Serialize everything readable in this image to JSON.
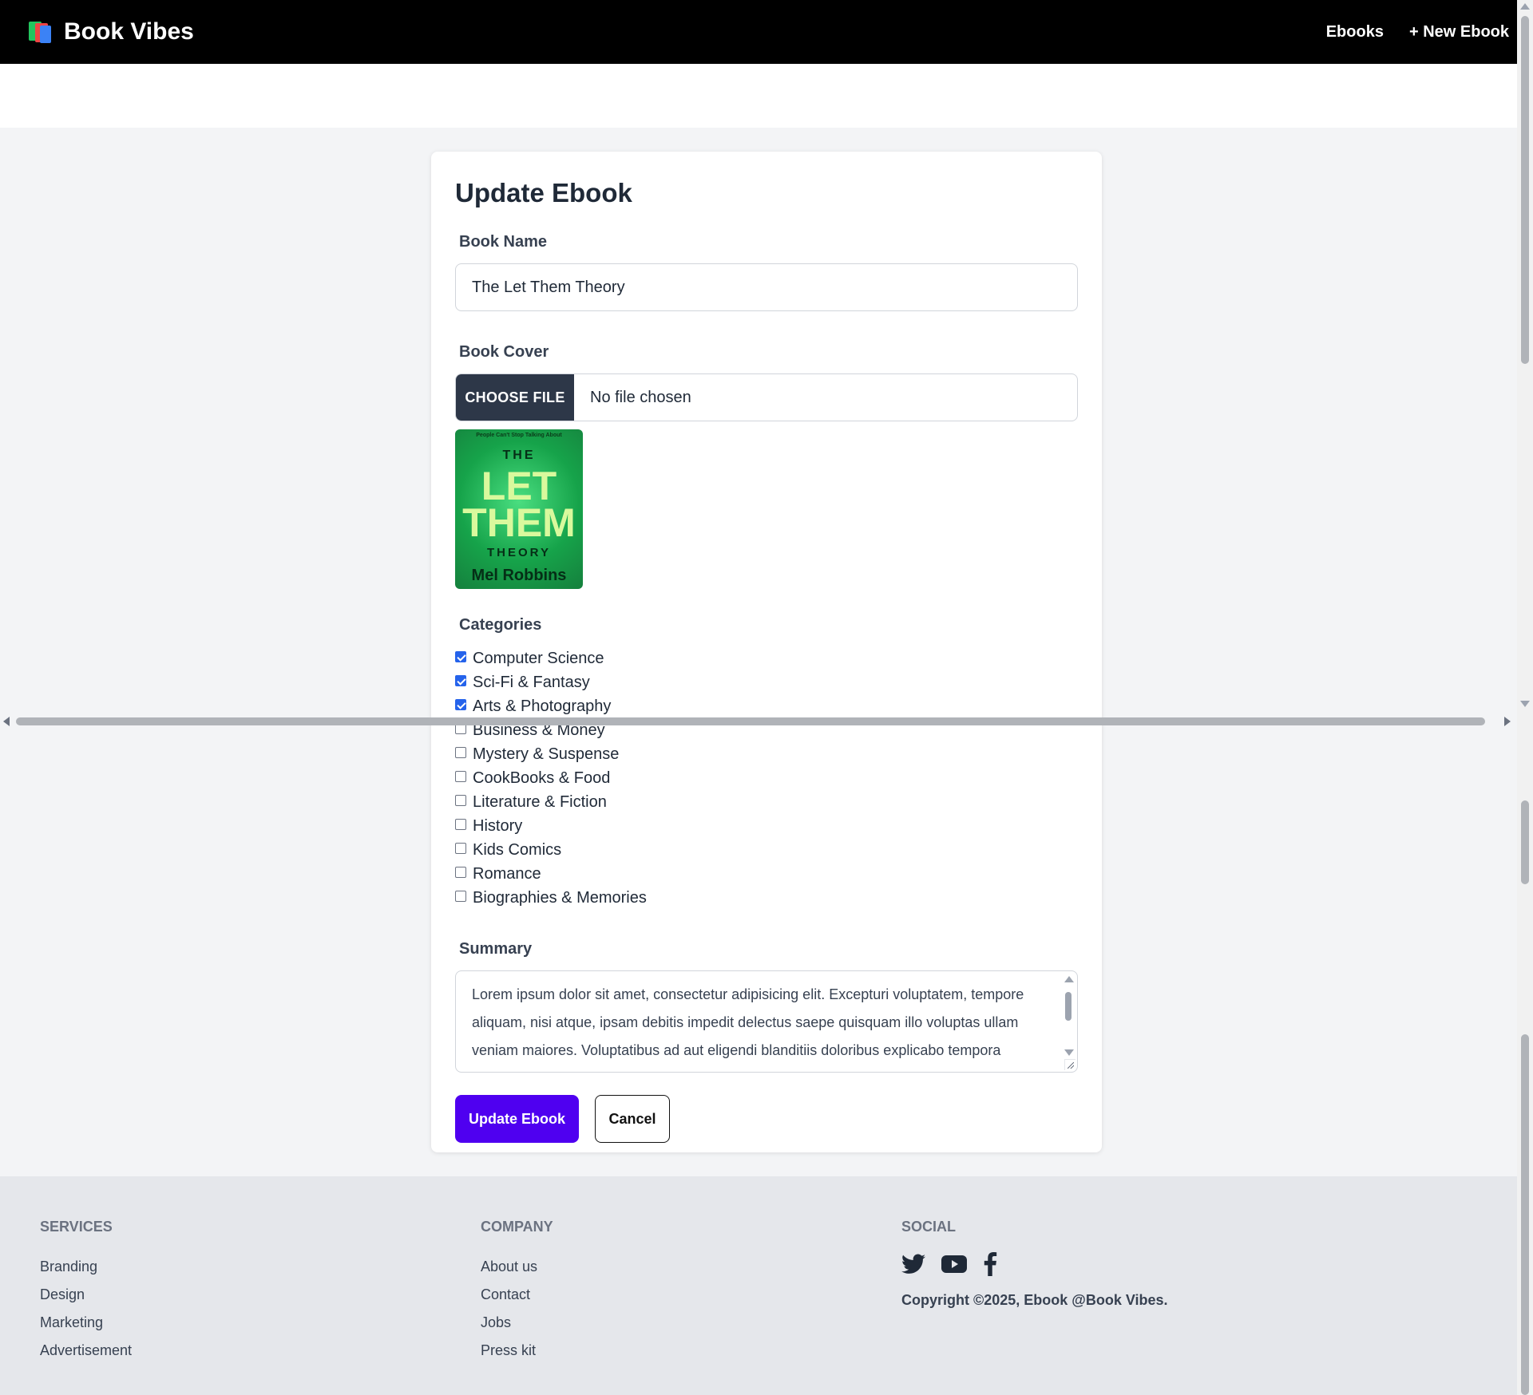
{
  "navbar": {
    "brand": "Book Vibes",
    "links": [
      "Ebooks",
      "+ New Ebook"
    ]
  },
  "form": {
    "title": "Update Ebook",
    "book_name_label": "Book Name",
    "book_name_value": "The Let Them Theory",
    "book_cover_label": "Book Cover",
    "choose_file_label": "CHOOSE FILE",
    "file_status": "No file chosen",
    "cover_image": {
      "top_text": "People Can't Stop Talking About",
      "line1": "THE",
      "line2": "LET",
      "line3": "THEM",
      "line4": "THEORY",
      "author": "Mel Robbins"
    },
    "categories_label": "Categories",
    "categories": [
      {
        "label": "Computer Science",
        "checked": true
      },
      {
        "label": "Sci-Fi & Fantasy",
        "checked": true
      },
      {
        "label": "Arts & Photography",
        "checked": true
      },
      {
        "label": "Business & Money",
        "checked": false
      },
      {
        "label": "Mystery & Suspense",
        "checked": false
      },
      {
        "label": "CookBooks & Food",
        "checked": false
      },
      {
        "label": "Literature & Fiction",
        "checked": false
      },
      {
        "label": "History",
        "checked": false
      },
      {
        "label": "Kids Comics",
        "checked": false
      },
      {
        "label": "Romance",
        "checked": false
      },
      {
        "label": "Biographies & Memories",
        "checked": false
      }
    ],
    "summary_label": "Summary",
    "summary_value": "Lorem ipsum dolor sit amet, consectetur adipisicing elit. Excepturi voluptatem, tempore aliquam, nisi atque, ipsam debitis impedit delectus saepe quisquam illo voluptas ullam veniam maiores. Voluptatibus ad aut eligendi blanditiis doloribus explicabo tempora",
    "submit_label": "Update Ebook",
    "cancel_label": "Cancel"
  },
  "footer": {
    "services": {
      "heading": "SERVICES",
      "links": [
        "Branding",
        "Design",
        "Marketing",
        "Advertisement"
      ]
    },
    "company": {
      "heading": "COMPANY",
      "links": [
        "About us",
        "Contact",
        "Jobs",
        "Press kit"
      ]
    },
    "social": {
      "heading": "SOCIAL",
      "icons": [
        "twitter-icon",
        "youtube-icon",
        "facebook-icon"
      ],
      "copyright": "Copyright ©2025, Ebook @Book Vibes."
    }
  },
  "colors": {
    "navbar_bg": "#000000",
    "primary_button": "#4f00f0",
    "checkbox_checked": "#2563eb"
  }
}
